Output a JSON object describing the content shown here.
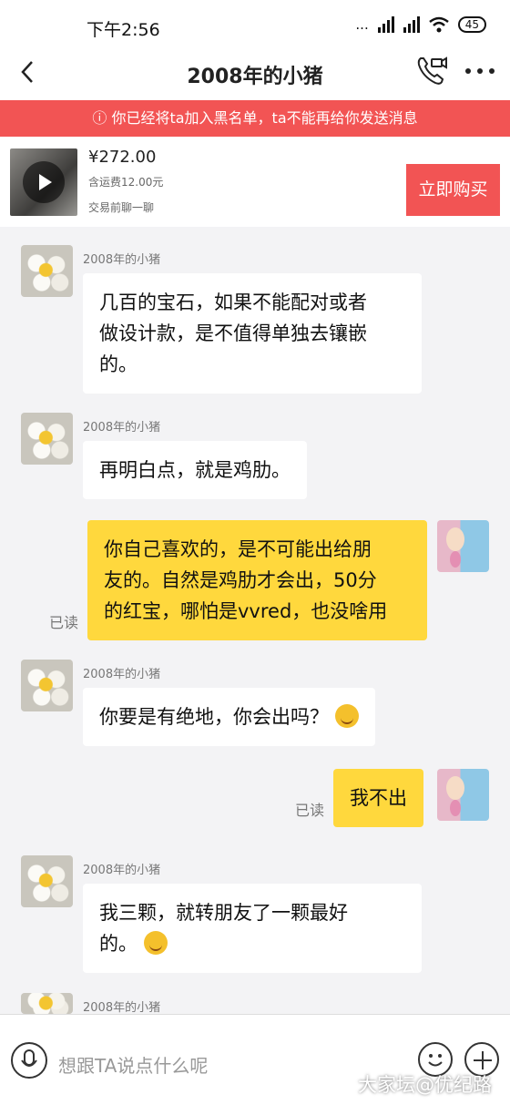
{
  "status": {
    "time": "下午2:56",
    "dots": "...",
    "battery": "45"
  },
  "header": {
    "title": "2008年的小猪"
  },
  "banner": {
    "text": "ⓘ 你已经将ta加入黑名单，ta不能再给你发送消息"
  },
  "product": {
    "price": "¥272.00",
    "shipping": "含运费12.00元",
    "hint": "交易前聊一聊",
    "buy_label": "立即购买"
  },
  "messages": [
    {
      "side": "left",
      "sender": "2008年的小猪",
      "lines": [
        "几百的宝石，如果不能配对或者",
        "做设计款，是不值得单独去镶嵌",
        "的。"
      ]
    },
    {
      "side": "left",
      "sender": "2008年的小猪",
      "lines": [
        "再明白点，就是鸡肋。"
      ]
    },
    {
      "side": "right",
      "read": "已读",
      "lines": [
        "你自己喜欢的，是不可能出给朋",
        "友的。自然是鸡肋才会出，50分",
        "的红宝，哪怕是vvred，也没啥用"
      ]
    },
    {
      "side": "left",
      "sender": "2008年的小猪",
      "lines": [
        "你要是有绝地，你会出吗？"
      ]
    },
    {
      "side": "right",
      "read": "已读",
      "lines": [
        "我不出"
      ]
    },
    {
      "side": "left",
      "sender": "2008年的小猪",
      "lines": [
        "我三颗，就转朋友了一颗最好",
        "的。"
      ]
    },
    {
      "side": "left",
      "sender": "2008年的小猪",
      "lines": []
    }
  ],
  "input": {
    "placeholder": "想跟TA说点什么呢"
  },
  "watermark": "大家坛@优纪路",
  "colors": {
    "banner": "#f25454",
    "own_bubble": "#ffd83d",
    "buy_button": "#f25454"
  }
}
